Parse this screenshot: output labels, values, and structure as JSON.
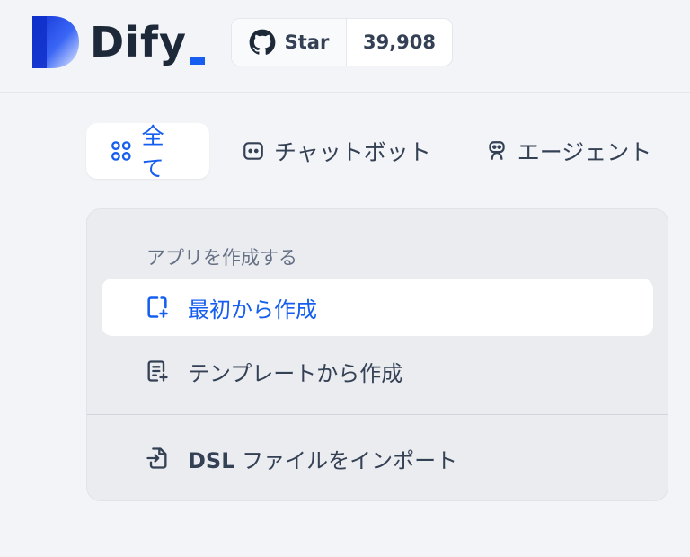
{
  "brand": {
    "name": "Dify",
    "accent": "#155eef"
  },
  "github": {
    "star_label": "Star",
    "count": "39,908"
  },
  "tabs": [
    {
      "label": "全て",
      "icon": "grid-icon",
      "active": true
    },
    {
      "label": "チャットボット",
      "icon": "chatbot-icon",
      "active": false
    },
    {
      "label": "エージェント",
      "icon": "agent-icon",
      "active": false
    }
  ],
  "create_menu": {
    "title": "アプリを作成する",
    "items": [
      {
        "label": "最初から作成",
        "icon": "file-plus-icon",
        "active": true
      },
      {
        "label": "テンプレートから作成",
        "icon": "template-icon",
        "active": false
      }
    ],
    "import": {
      "prefix": "DSL",
      "label": " ファイルをインポート",
      "icon": "file-import-icon"
    }
  }
}
